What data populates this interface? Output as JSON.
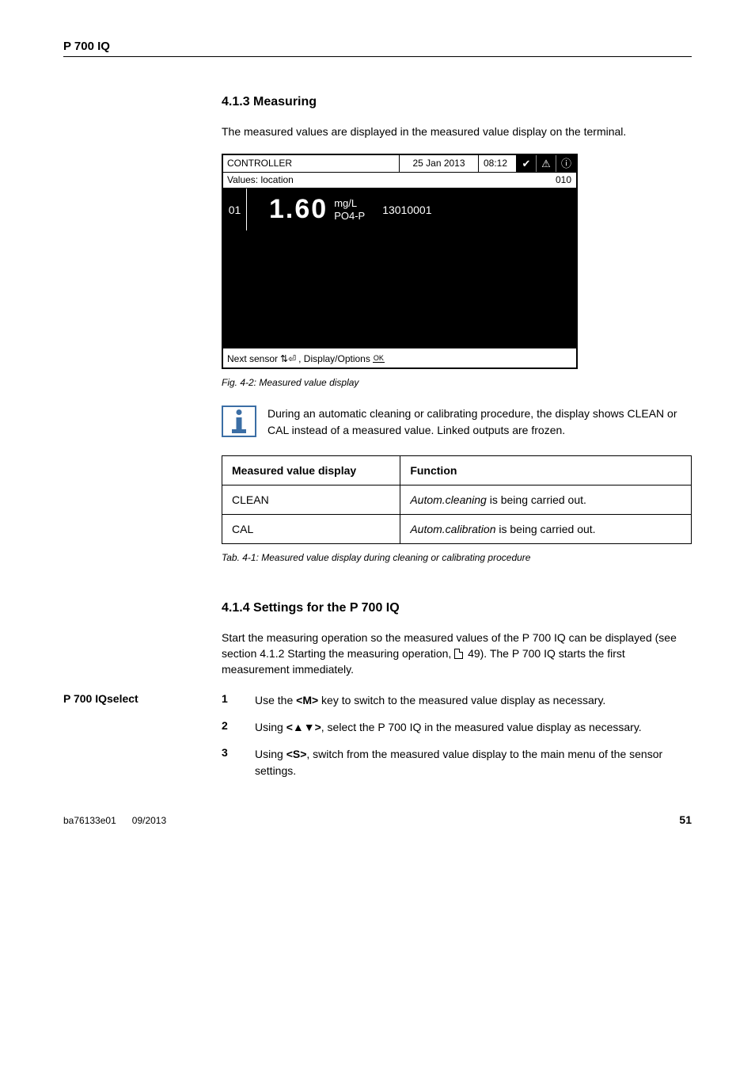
{
  "header": {
    "title": "P 700 IQ"
  },
  "section1": {
    "heading": "4.1.3  Measuring",
    "intro": "The measured values are displayed in the measured value display on the terminal."
  },
  "device": {
    "controller": "CONTROLLER",
    "date": "25 Jan  2013",
    "time": "08:12",
    "values_label": "Values: location",
    "values_code": "010",
    "channel": "01",
    "reading": "1.60",
    "unit_top": "mg/L",
    "unit_bottom": "PO4-P",
    "sensor_id": "13010001",
    "footer_a": "Next sensor ",
    "footer_b": ", Display/Options "
  },
  "fig_caption": "Fig. 4-2: Measured value display",
  "note_text": "During an automatic cleaning or calibrating procedure, the display shows CLEAN or CAL instead of a measured value. Linked outputs are frozen.",
  "table": {
    "head_col1": "Measured value display",
    "head_col2": "Function",
    "row1_c1": "CLEAN",
    "row1_c2a": "Autom.cleaning",
    "row1_c2b": " is being carried out.",
    "row2_c1": "CAL",
    "row2_c2a": "Autom.calibration",
    "row2_c2b": " is being carried out."
  },
  "tab_caption": "Tab. 4-1: Measured value display during cleaning or calibrating procedure",
  "section2": {
    "heading": "4.1.4  Settings for the P 700 IQ",
    "intro_a": "Start the measuring operation so the measured values of the P 700 IQ can be displayed (see section 4.1.2 Starting the measuring operation, ",
    "intro_b": " 49). The P 700 IQ starts the first measurement immediately."
  },
  "steps": {
    "side_label": "P 700 IQselect",
    "s1_num": "1",
    "s1_a": "Use the ",
    "s1_key": "<M>",
    "s1_b": " key to switch to the measured value display as necessary.",
    "s2_num": "2",
    "s2_a": "Using ",
    "s2_key": "<▲▼>",
    "s2_b": ", select the P 700 IQ in the measured value display as necessary.",
    "s3_num": "3",
    "s3_a": "Using ",
    "s3_key": "<S>",
    "s3_b": ", switch from the measured value display to the main menu of the sensor settings."
  },
  "footer": {
    "left_a": "ba76133e01",
    "left_b": "09/2013",
    "page": "51"
  }
}
